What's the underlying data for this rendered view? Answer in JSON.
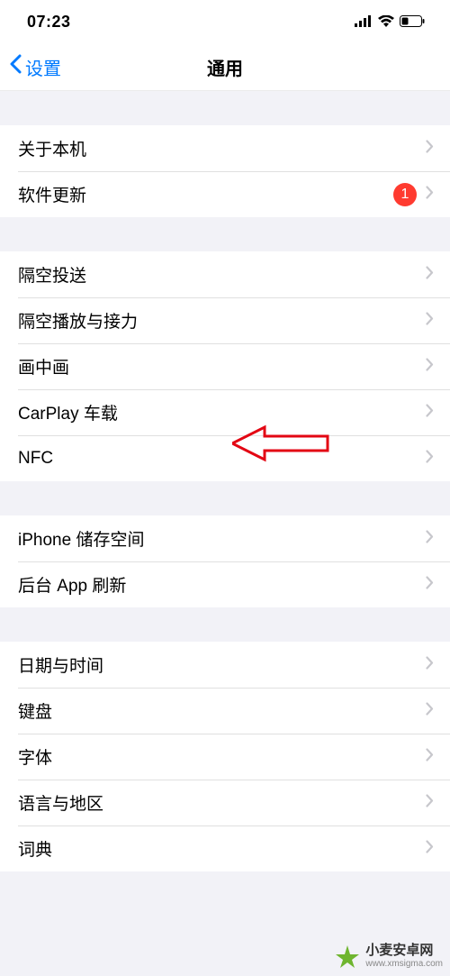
{
  "status_bar": {
    "time": "07:23"
  },
  "nav": {
    "back_label": "设置",
    "title": "通用"
  },
  "groups": [
    {
      "rows": [
        {
          "label": "关于本机",
          "badge": null
        },
        {
          "label": "软件更新",
          "badge": "1"
        }
      ]
    },
    {
      "rows": [
        {
          "label": "隔空投送",
          "badge": null
        },
        {
          "label": "隔空播放与接力",
          "badge": null
        },
        {
          "label": "画中画",
          "badge": null
        },
        {
          "label": "CarPlay 车载",
          "badge": null
        },
        {
          "label": "NFC",
          "badge": null
        }
      ]
    },
    {
      "rows": [
        {
          "label": "iPhone 储存空间",
          "badge": null
        },
        {
          "label": "后台 App 刷新",
          "badge": null
        }
      ]
    },
    {
      "rows": [
        {
          "label": "日期与时间",
          "badge": null
        },
        {
          "label": "键盘",
          "badge": null
        },
        {
          "label": "字体",
          "badge": null
        },
        {
          "label": "语言与地区",
          "badge": null
        },
        {
          "label": "词典",
          "badge": null
        }
      ]
    }
  ],
  "watermark": {
    "main_text": "小麦安卓网",
    "sub_text": "www.xmsigma.com"
  }
}
